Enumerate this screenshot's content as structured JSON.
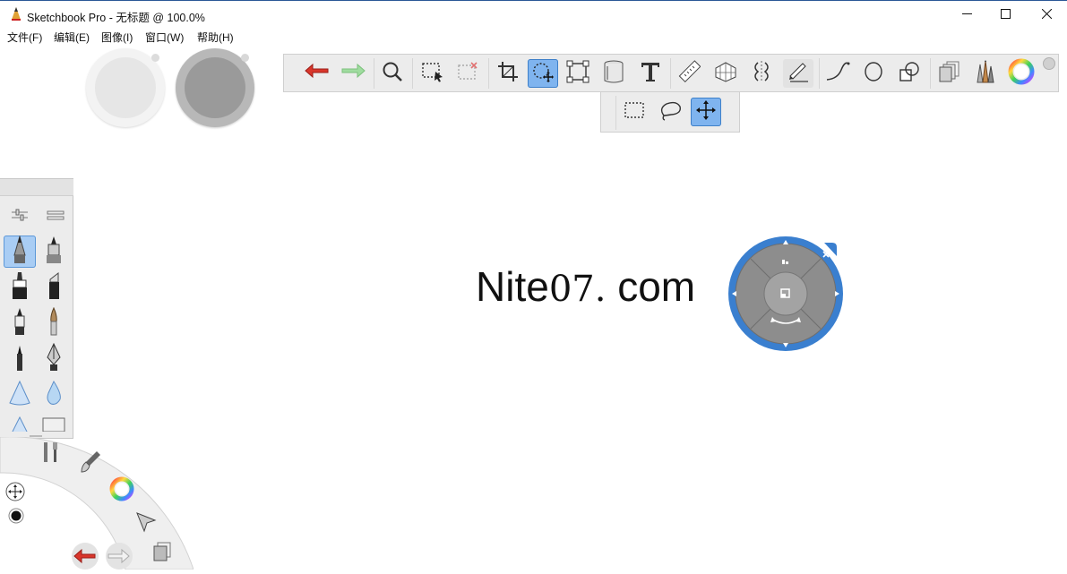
{
  "window": {
    "title": "Sketchbook Pro - 无标题 @ 100.0%",
    "app_icon": "pencil-icon",
    "controls": [
      "minimize-icon",
      "maximize-icon",
      "close-icon"
    ]
  },
  "menu": {
    "items": [
      {
        "label": "文件(F)"
      },
      {
        "label": "编辑(E)"
      },
      {
        "label": "图像(I)"
      },
      {
        "label": "窗口(W)"
      },
      {
        "label": "帮助(H)"
      }
    ]
  },
  "toolbar": {
    "tools": [
      "undo-icon",
      "redo-icon",
      "zoom-icon",
      "select-icon",
      "deselect-icon",
      "crop-icon",
      "transform-icon",
      "distort-icon",
      "fill-icon",
      "text-icon",
      "ruler-icon",
      "perspective-icon",
      "symmetry-icon",
      "stroke-icon",
      "curve-icon",
      "ellipse-icon",
      "shape-icon",
      "layers-icon",
      "brushes-icon",
      "color-wheel-icon"
    ],
    "active_tool": "transform-icon",
    "subtools": [
      "rect-select-icon",
      "lasso-icon",
      "move-icon"
    ],
    "active_subtool": "move-icon"
  },
  "canvas": {
    "text_sans": "Nite",
    "text_serif": "07.",
    "text_tail": " com"
  },
  "colors": {
    "accent": "#3f86d3",
    "puck_blue": "#3a7fcf",
    "toolbar_bg": "#ececec",
    "undo_red": "#d9362b",
    "redo_green": "#8dd48d"
  }
}
